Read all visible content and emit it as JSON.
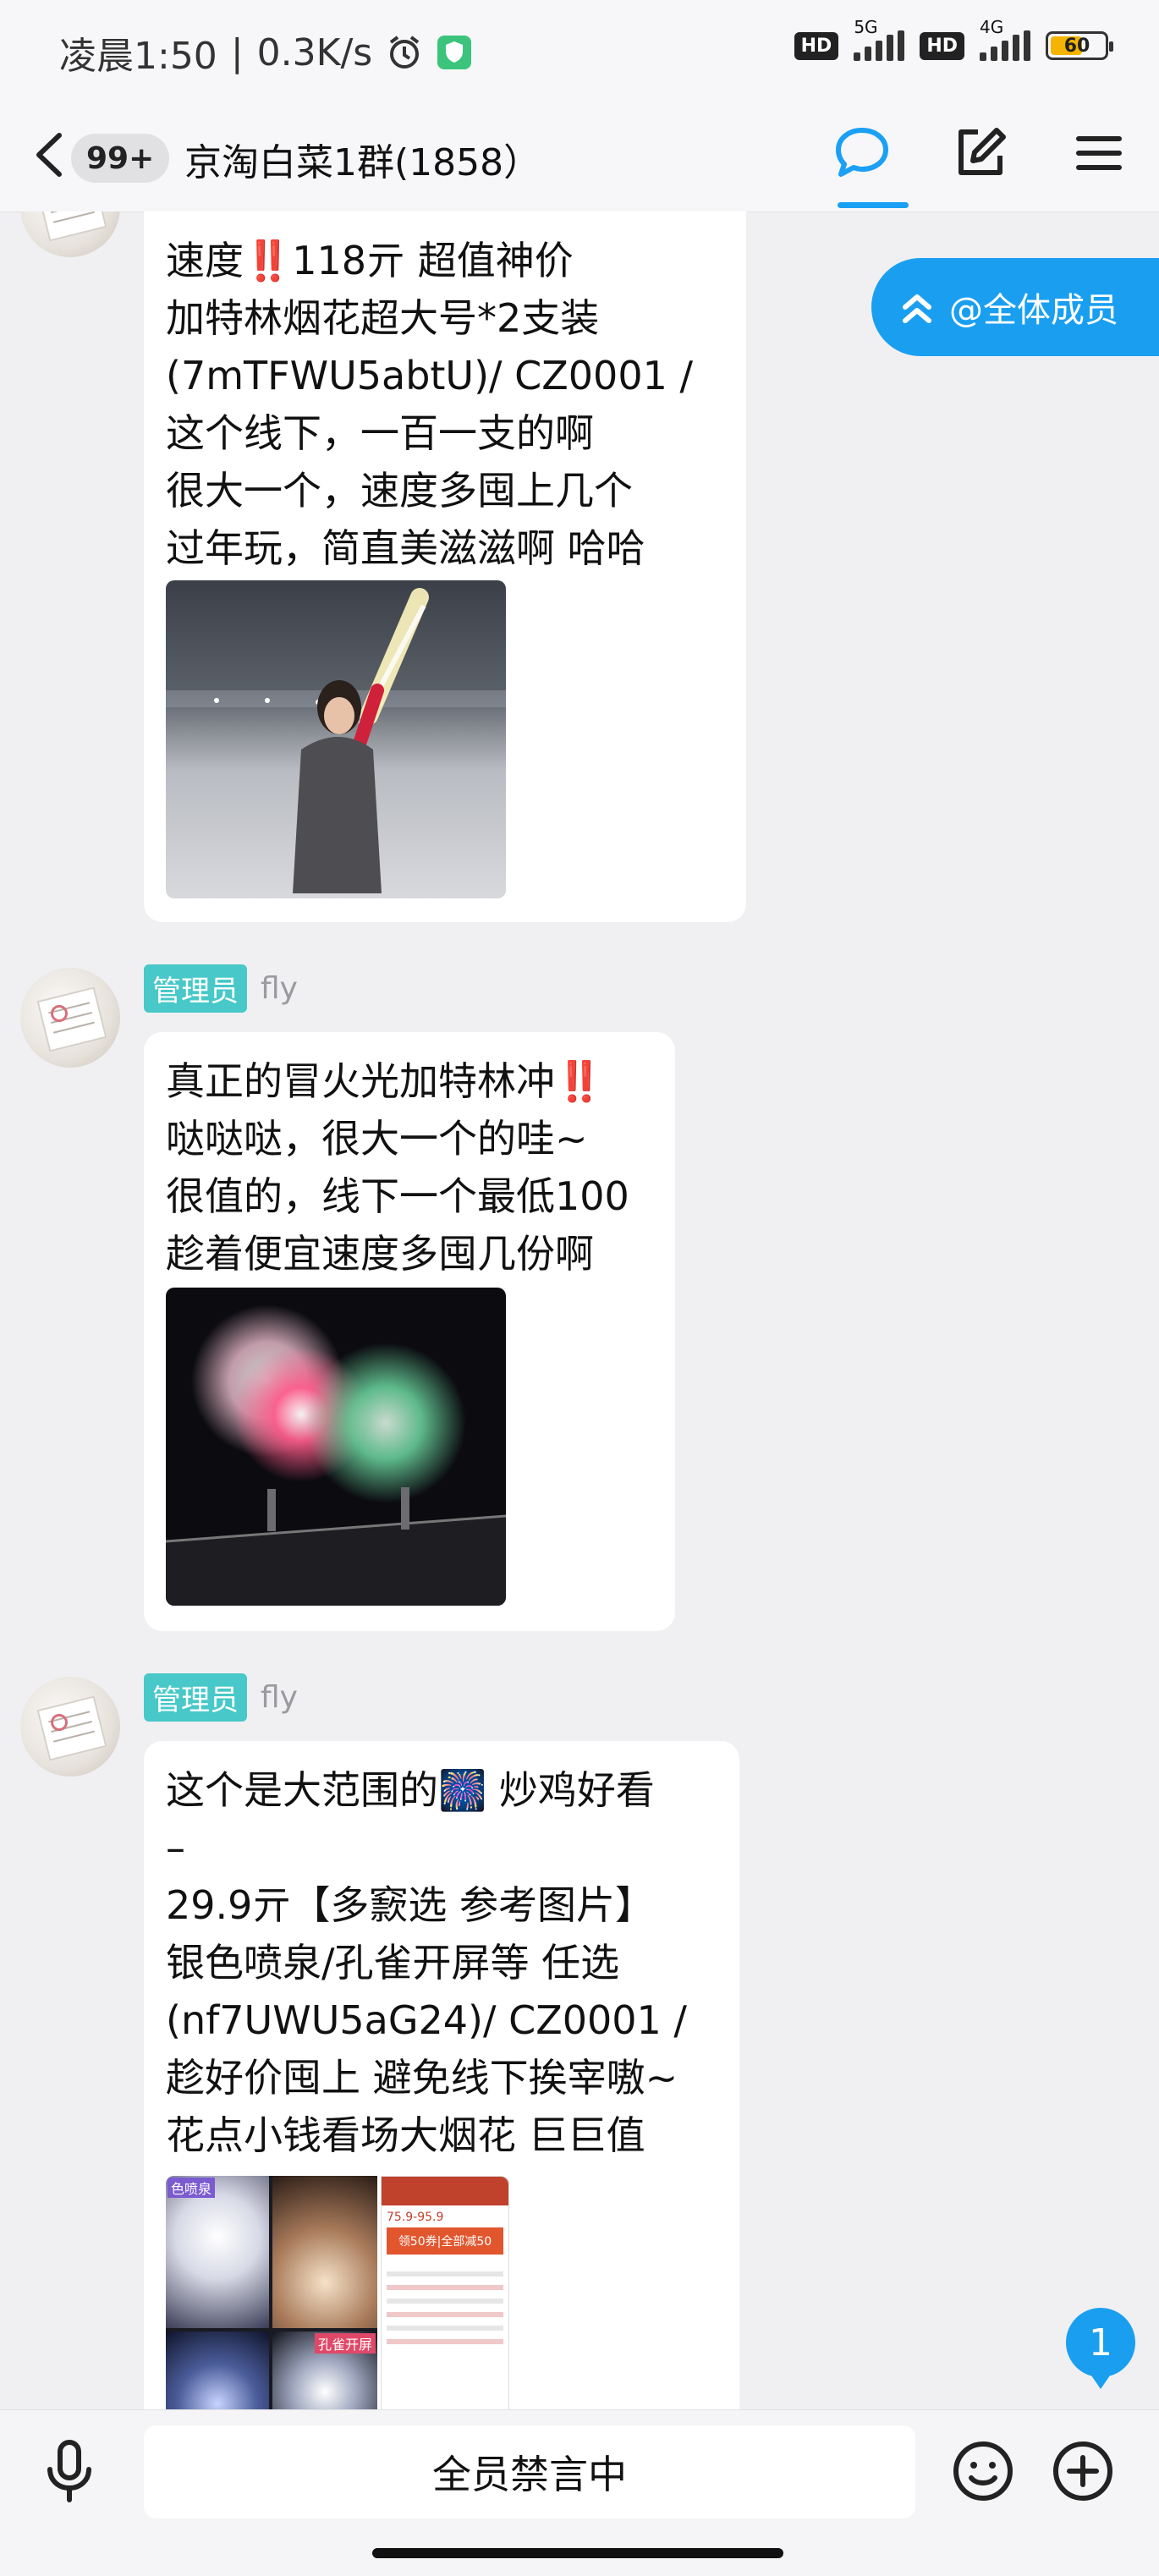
{
  "status_bar": {
    "time": "凌晨1:50",
    "net_speed": "0.3K/s",
    "signal_1_label": "5G",
    "signal_2_label": "4G",
    "hd_label": "HD",
    "battery": "60",
    "battery_level": 0.6
  },
  "header": {
    "unread_count": "99+",
    "title": "京淘白菜1群(1858）"
  },
  "at_all_label": "@全体成员",
  "messages": [
    {
      "lines": [
        "速度‼️118亓  超值神价",
        "加特林烟花超大号*2支装",
        "(7mTFWU5abtU)/ CZ0001 /",
        "这个线下，一百一支的啊",
        "很大一个，速度多囤上几个",
        "过年玩，简直美滋滋啊 哈哈"
      ]
    },
    {
      "role": "管理员",
      "name": "fly",
      "lines": [
        "真正的冒火光加特林冲‼️",
        "哒哒哒，很大一个的哇~",
        "很值的，线下一个最低100",
        "趁着便宜速度多囤几份啊"
      ]
    },
    {
      "role": "管理员",
      "name": "fly",
      "lines": [
        "这个是大范围的🎆 炒鸡好看",
        "–",
        "29.9亓【多窾选 参考图片】",
        "银色喷泉/孔雀开屏等 任选",
        "(nf7UWU5aG24)/ CZ0001 /",
        "趁好价囤上 避免线下挨宰嗷~",
        "花点小钱看场大烟花 巨巨值"
      ],
      "grid_labels": [
        "色喷泉",
        "孔雀开屏"
      ],
      "promo_texts": [
        "75.9-95.9",
        "领50券|全部减50"
      ]
    }
  ],
  "unread_new": "1",
  "input_bar": {
    "mute_text": "全员禁言中"
  },
  "colors": {
    "accent": "#1a9ff0",
    "admin_badge": "#48c8c8",
    "background": "#f0f0f2"
  }
}
